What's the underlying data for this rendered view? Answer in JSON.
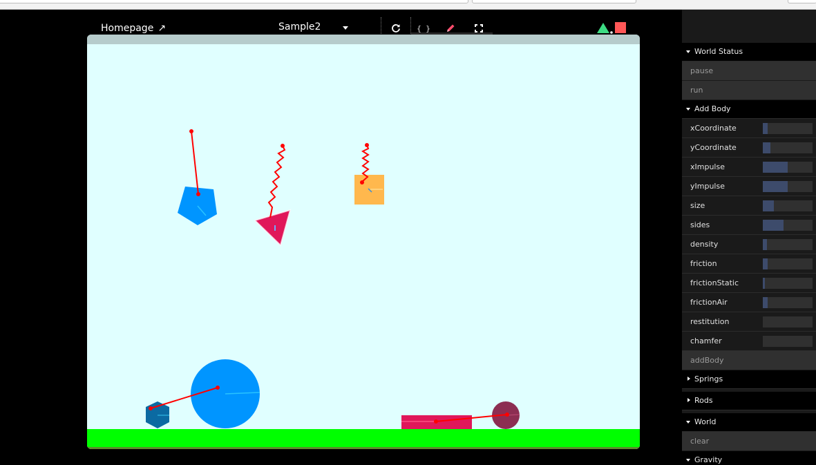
{
  "header": {
    "homepage_label": "Homepage",
    "homepage_arrow": "↗",
    "sample_selected": "Sample2",
    "toolbar": {
      "icons": [
        "refresh-icon",
        "code-braces-icon",
        "pencil-icon",
        "fullscreen-icon"
      ],
      "code_glyph": "{ }"
    },
    "render_icons": {
      "triangle_color": "#3ddc84",
      "square_color": "#ff5757"
    }
  },
  "world": {
    "sky_color": "#e0ffff",
    "ceiling_color": "#b6cccc",
    "ground_color": "#00ff00",
    "ground_edge_color": "#5d8a2c",
    "constraint_color": "#ff0000",
    "bodies": [
      {
        "id": "pentagon",
        "color": "#0095ff"
      },
      {
        "id": "triangle",
        "color": "#e0175a"
      },
      {
        "id": "square",
        "color": "#ffb84d"
      },
      {
        "id": "big-circle",
        "color": "#0095ff"
      },
      {
        "id": "hexagon",
        "color": "#0b6aa2"
      },
      {
        "id": "rectangle",
        "color": "#e0175a"
      },
      {
        "id": "small-circle",
        "color": "#8c2e52"
      }
    ]
  },
  "panel": {
    "folders": {
      "world_status": "World Status",
      "add_body": "Add Body",
      "springs": "Springs",
      "rods": "Rods",
      "world": "World",
      "gravity": "Gravity"
    },
    "buttons": {
      "pause": "pause",
      "run": "run",
      "addBody": "addBody",
      "clear": "clear"
    },
    "params": [
      {
        "label": "xCoordinate",
        "value": 0.1
      },
      {
        "label": "yCoordinate",
        "value": 0.15
      },
      {
        "label": "xImpulse",
        "value": 0.5
      },
      {
        "label": "yImpulse",
        "value": 0.5
      },
      {
        "label": "size",
        "value": 0.22
      },
      {
        "label": "sides",
        "value": 0.42
      },
      {
        "label": "density",
        "value": 0.08
      },
      {
        "label": "friction",
        "value": 0.1
      },
      {
        "label": "frictionStatic",
        "value": 0.04
      },
      {
        "label": "frictionAir",
        "value": 0.1
      },
      {
        "label": "restitution",
        "value": 0
      },
      {
        "label": "chamfer",
        "value": 0
      }
    ]
  }
}
